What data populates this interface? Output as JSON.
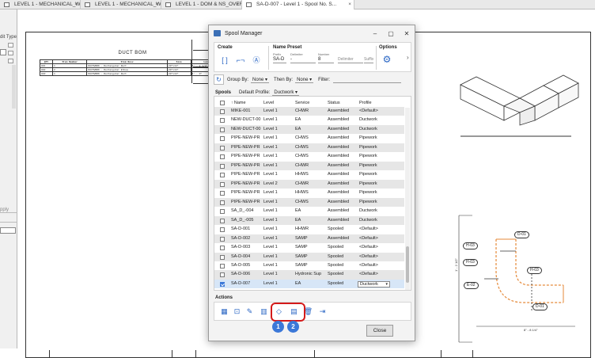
{
  "tabs": [
    {
      "label": "LEVEL 1 - MECHANICAL_WORKING",
      "active": false
    },
    {
      "label": "LEVEL 1 - MECHANICAL_WORKING...",
      "active": false
    },
    {
      "label": "LEVEL 1 - DOM & NS_OVERALL",
      "active": false
    },
    {
      "label": "SA-D-007 - Level 1 - Spool No. S...",
      "active": true
    }
  ],
  "left_panel": {
    "label": "dit Type",
    "apply": "pply"
  },
  "drawing": {
    "bom_title": "DUCT BOM",
    "bom_headers": [
      "QTY",
      "Item Number",
      "Item Desc",
      "Size",
      "Length"
    ],
    "bom_rows": [
      [
        "001",
        "1",
        "DUCTWORK - Rectangular Duct",
        "20\"x14\"",
        "4' - 8 1/4\""
      ],
      [
        "002",
        "2",
        "DUCTWORK - Rectangular Elbow",
        "20\"x14\"",
        "-"
      ],
      [
        "003",
        "1",
        "DUCTWORK - Rectangular Duct",
        "20\"x14\"",
        "4' - 0\""
      ]
    ],
    "tags": [
      "D-01",
      "H-03",
      "H-03",
      "H-03",
      "E-02",
      "D-01"
    ],
    "dims": [
      "1' - 2 1/2\"",
      "8\" - 8 1/4\""
    ]
  },
  "window": {
    "title": "Spool Manager",
    "create_label": "Create",
    "name_preset_label": "Name Preset",
    "prefix_label": "Prefix",
    "prefix_value": "SA-D",
    "delimiter_label": "Delimiter",
    "delimiter_value": "-",
    "number_label": "Number",
    "number_value": "8",
    "delimiter2": "Delimiter",
    "suffix": "Suffix",
    "options_label": "Options",
    "group_by_label": "Group By:",
    "group_by_value": "None",
    "then_by_label": "Then By:",
    "then_by_value": "None",
    "filter_label": "Filter:",
    "spools_label": "Spools",
    "default_profile_label": "Default Profile:",
    "default_profile_value": "Ductwork",
    "columns": [
      "Name",
      "Level",
      "Service",
      "Status",
      "Profile"
    ],
    "rows": [
      {
        "name": "MIKE-001",
        "level": "Level 1",
        "service": "CHWR",
        "status": "Assembled",
        "profile": "<Default>",
        "checked": false
      },
      {
        "name": "NEW-DUCT-00",
        "level": "Level 1",
        "service": "EA",
        "status": "Assembled",
        "profile": "Ductwork",
        "checked": false
      },
      {
        "name": "NEW-DUCT-00",
        "level": "Level 1",
        "service": "EA",
        "status": "Assembled",
        "profile": "Ductwork",
        "checked": false
      },
      {
        "name": "PIPE-NEW-PR",
        "level": "Level 1",
        "service": "CHWS",
        "status": "Assembled",
        "profile": "Pipework",
        "checked": false
      },
      {
        "name": "PIPE-NEW-PR",
        "level": "Level 1",
        "service": "CHWS",
        "status": "Assembled",
        "profile": "Pipework",
        "checked": false
      },
      {
        "name": "PIPE-NEW-PR",
        "level": "Level 1",
        "service": "CHWS",
        "status": "Assembled",
        "profile": "Pipework",
        "checked": false
      },
      {
        "name": "PIPE-NEW-PR",
        "level": "Level 1",
        "service": "CHWR",
        "status": "Assembled",
        "profile": "Pipework",
        "checked": false
      },
      {
        "name": "PIPE-NEW-PR",
        "level": "Level 1",
        "service": "HHWS",
        "status": "Assembled",
        "profile": "Pipework",
        "checked": false
      },
      {
        "name": "PIPE-NEW-PR",
        "level": "Level 2",
        "service": "CHWR",
        "status": "Assembled",
        "profile": "Pipework",
        "checked": false
      },
      {
        "name": "PIPE-NEW-PR",
        "level": "Level 1",
        "service": "HHWS",
        "status": "Assembled",
        "profile": "Pipework",
        "checked": false
      },
      {
        "name": "PIPE-NEW-PR",
        "level": "Level 1",
        "service": "CHWS",
        "status": "Assembled",
        "profile": "Pipework",
        "checked": false
      },
      {
        "name": "SA_D_-004",
        "level": "Level 1",
        "service": "EA",
        "status": "Assembled",
        "profile": "Ductwork",
        "checked": false
      },
      {
        "name": "SA_D_-005",
        "level": "Level 1",
        "service": "EA",
        "status": "Assembled",
        "profile": "Ductwork",
        "checked": false
      },
      {
        "name": "SA-D-001",
        "level": "Level 1",
        "service": "HHWR",
        "status": "Spooled",
        "profile": "<Default>",
        "checked": false
      },
      {
        "name": "SA-D-002",
        "level": "Level 1",
        "service": "SAMP",
        "status": "Assembled",
        "profile": "<Default>",
        "checked": false
      },
      {
        "name": "SA-D-003",
        "level": "Level 1",
        "service": "SAMP",
        "status": "Spooled",
        "profile": "<Default>",
        "checked": false
      },
      {
        "name": "SA-D-004",
        "level": "Level 1",
        "service": "SAMP",
        "status": "Spooled",
        "profile": "<Default>",
        "checked": false
      },
      {
        "name": "SA-D-005",
        "level": "Level 1",
        "service": "SAMP",
        "status": "Spooled",
        "profile": "<Default>",
        "checked": false
      },
      {
        "name": "SA-D-006",
        "level": "Level 1",
        "service": "Hydronic Sup",
        "status": "Spooled",
        "profile": "<Default>",
        "checked": false
      },
      {
        "name": "SA-D-007",
        "level": "Level 1",
        "service": "EA",
        "status": "Spooled",
        "profile": "Ductwork",
        "checked": true
      }
    ],
    "actions_label": "Actions",
    "badge_1": "1",
    "badge_2": "2",
    "close_label": "Close"
  }
}
